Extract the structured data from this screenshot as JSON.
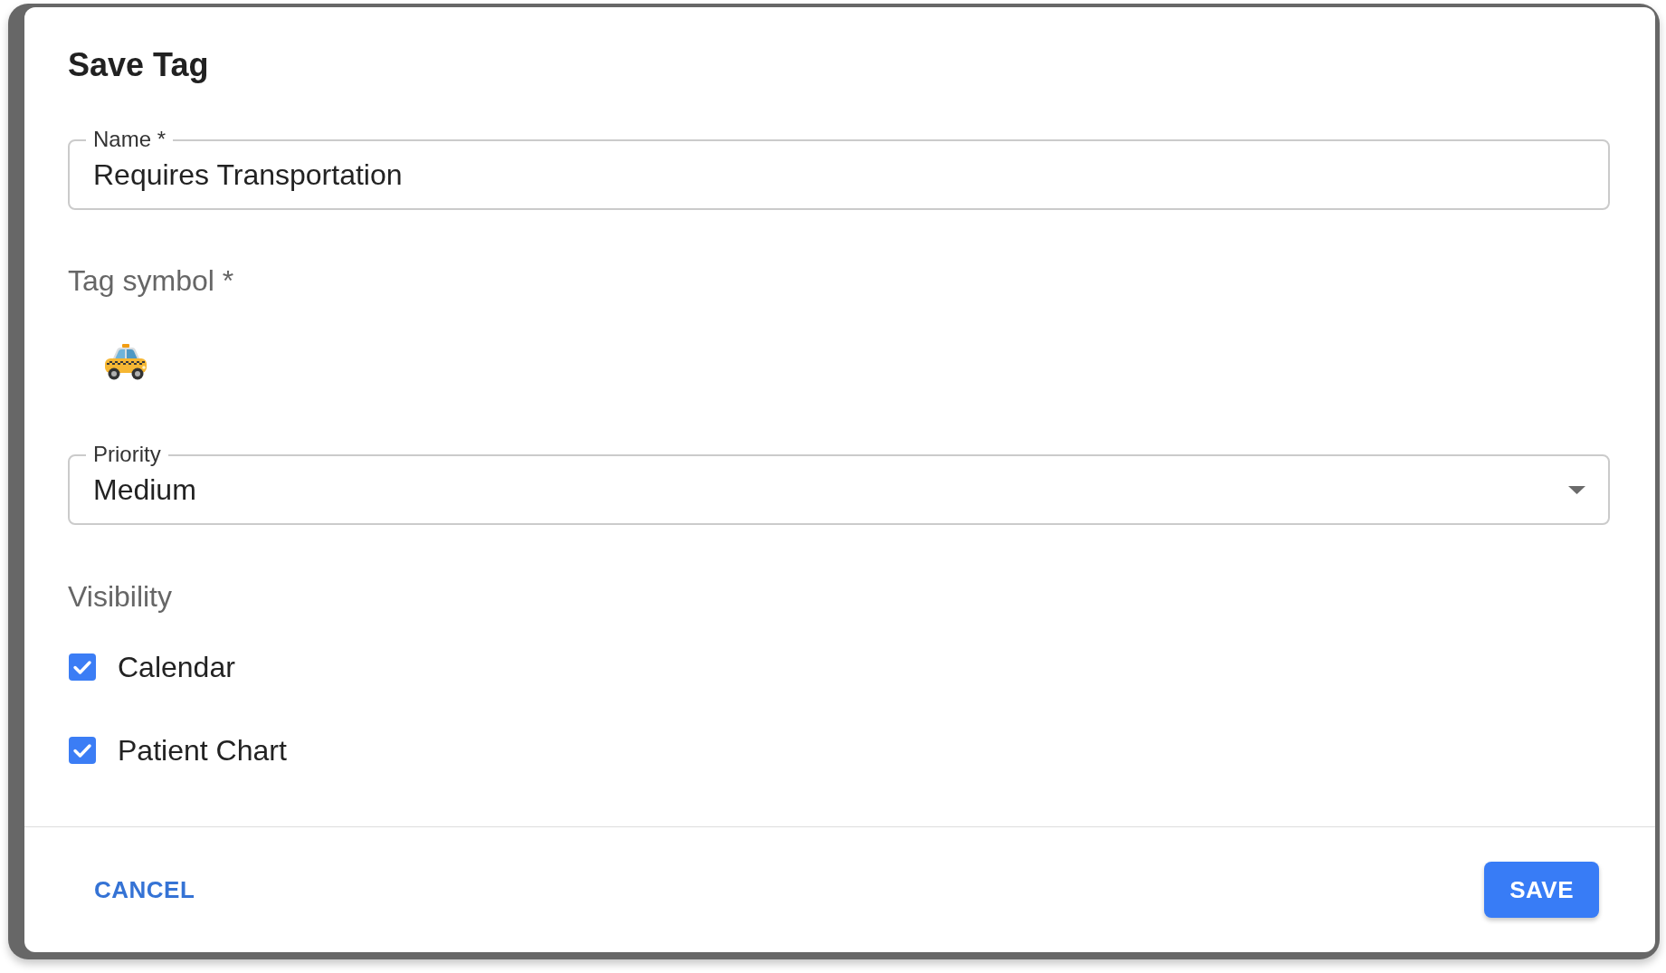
{
  "dialog": {
    "title": "Save Tag"
  },
  "name_field": {
    "label": "Name *",
    "value": "Requires Transportation"
  },
  "tag_symbol": {
    "label": "Tag symbol *"
  },
  "priority_field": {
    "label": "Priority",
    "value": "Medium"
  },
  "visibility": {
    "label": "Visibility",
    "options": [
      {
        "label": "Calendar",
        "checked": true
      },
      {
        "label": "Patient Chart",
        "checked": true
      }
    ]
  },
  "buttons": [
    {
      "label": "CANCEL",
      "kind": "text"
    },
    {
      "label": "SAVE",
      "kind": "contained"
    }
  ]
}
